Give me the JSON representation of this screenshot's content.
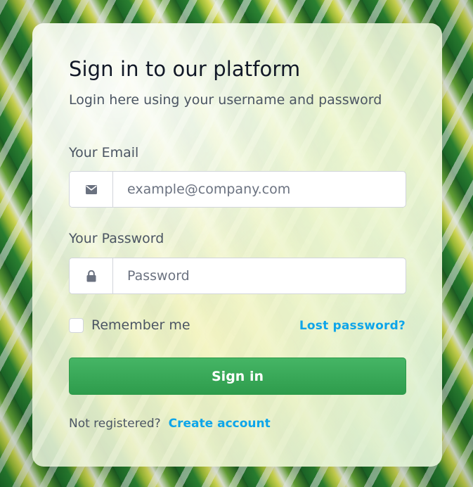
{
  "card": {
    "title": "Sign in to our platform",
    "subtitle": "Login here using your username and password"
  },
  "email": {
    "label": "Your Email",
    "placeholder": "example@company.com",
    "value": "",
    "icon": "envelope-icon"
  },
  "password": {
    "label": "Your Password",
    "placeholder": "Password",
    "value": "",
    "icon": "lock-icon"
  },
  "remember": {
    "label": "Remember me",
    "checked": false
  },
  "lost_password_link": "Lost password?",
  "signin_button": "Sign in",
  "register": {
    "text": "Not registered?",
    "link": "Create account"
  },
  "colors": {
    "primary_green": "#31a24c",
    "link_blue": "#0ea5e9",
    "icon_gray": "#6b7280"
  }
}
